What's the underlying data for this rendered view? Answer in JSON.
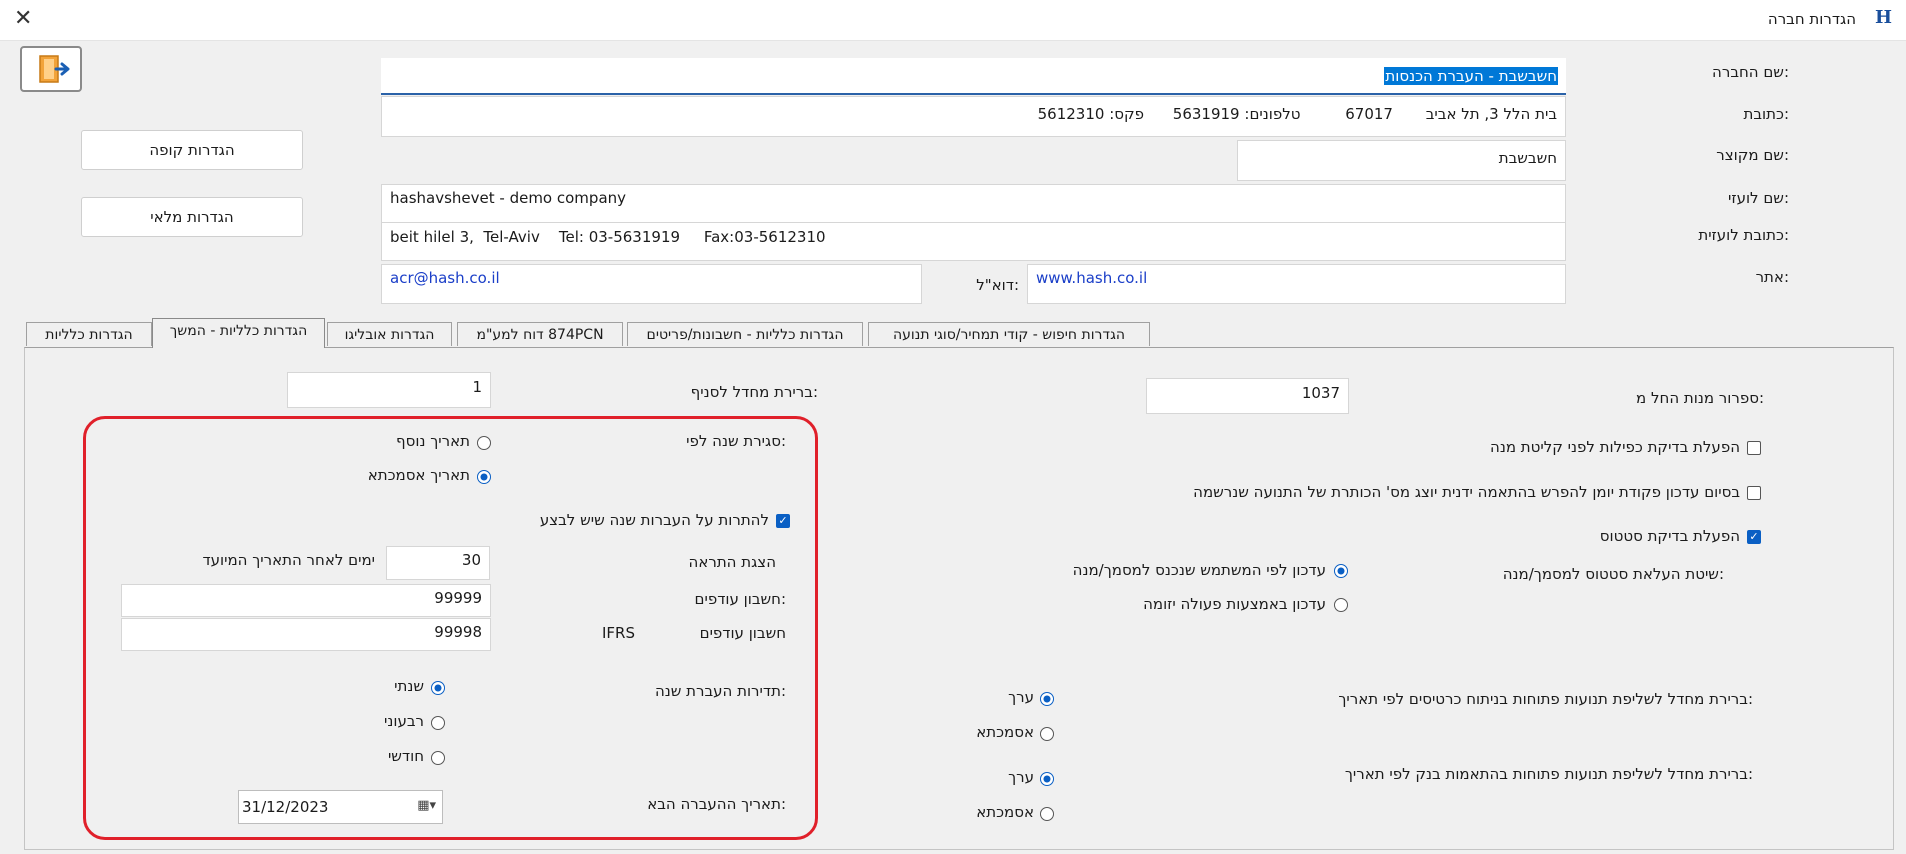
{
  "window": {
    "title": "הגדרות חברה",
    "app_icon": "H"
  },
  "company": {
    "name_label": "שם החברה:",
    "name_value": "חשבשבת - העברת הכנסות",
    "address_label": "כתובת:",
    "address": {
      "street": "בית הלל 3, תל אביב",
      "zip": "67017",
      "phone_label": "טלפונים:",
      "phone": "5631919",
      "fax_label": "פקס:",
      "fax": "5612310"
    },
    "short_name_label": "שם מקוצר:",
    "short_name": "חשבשבת",
    "foreign_name_label": "שם לועזי:",
    "foreign_name": "hashavshevet - demo company",
    "foreign_address_label": "כתובת לועזית:",
    "foreign_address": "beit hilel 3,  Tel-Aviv    Tel: 03-5631919     Fax:03-5612310",
    "site_label": "אתר:",
    "site": "www.hash.co.il",
    "email_label": "דוא\"ל:",
    "email": "acr@hash.co.il"
  },
  "buttons": {
    "cash_settings": "הגדרות קופה",
    "inventory_settings": "הגדרות מלאי"
  },
  "tabs": [
    {
      "label": "הגדרות כלליות",
      "active": false
    },
    {
      "label": "הגדרות כלליות - המשך",
      "active": true
    },
    {
      "label": "הגדרות אובליגו",
      "active": false
    },
    {
      "label": "874PCN  דוח למע\"מ",
      "active": false
    },
    {
      "label": "הגדרות כלליות - חשבונות/פריטים",
      "active": false
    },
    {
      "label": "הגדרות חיפוש - קודי תמחיר/סוגי תנועה",
      "active": false
    }
  ],
  "right_panel": {
    "batch_numbering_label": "ספרור מנות החל מ:",
    "batch_numbering_value": "1037",
    "dup_check_label": "הפעלת בדיקת כפילות לפני קליטת מנה",
    "dup_check": false,
    "journal_update_label": "בסיום עדכון פקודת יומן להפרש בהתאמה ידנית יוצג מס' הכותרת של התנועה שנרשמה",
    "journal_update": false,
    "status_check_label": "הפעלת בדיקת סטטוס",
    "status_check": true,
    "status_method_label": "שיטת העלאת סטטוס למסמך/מנה:",
    "status_method_options": [
      {
        "label": "עדכון לפי המשתמש שנכנס למסמך/מנה",
        "selected": true
      },
      {
        "label": "עדכון באמצעות פעולה יזומה",
        "selected": false
      }
    ],
    "card_analysis_label": "ברירת מחדל לשליפת תנועות פתוחות בניתוח כרטיסים לפי תאריך:",
    "card_analysis_options": [
      {
        "label": "ערך",
        "selected": true
      },
      {
        "label": "אסמכתא",
        "selected": false
      }
    ],
    "bank_match_label": "ברירת מחדל לשליפת תנועות פתוחות בהתאמות בנק לפי תאריך:",
    "bank_match_options": [
      {
        "label": "ערך",
        "selected": true
      },
      {
        "label": "אסמכתא",
        "selected": false
      }
    ]
  },
  "left_panel": {
    "branch_default_label": "ברירת מחדל לסניף:",
    "branch_default_value": "1",
    "year_close_label": "סגירת שנה לפי:",
    "year_close_options": [
      {
        "label": "תאריך נוסף",
        "selected": false
      },
      {
        "label": "תאריך אסמכתא",
        "selected": true
      }
    ],
    "alert_label": "להתרות על העברות שנה שיש לבצע",
    "alert": true,
    "show_alert_label": "הצגת התראה",
    "show_alert_days": "30",
    "show_alert_suffix": "ימים לאחר התאריך המיועד",
    "surplus_label": "חשבון עודפים:",
    "surplus_value": "99999",
    "surplus_ifrs_label": "חשבון עודפים",
    "ifrs_tag": "IFRS",
    "surplus_ifrs_value": "99998",
    "transfer_freq_label": "תדירות העברת שנה:",
    "transfer_freq_options": [
      {
        "label": "שנתי",
        "selected": true
      },
      {
        "label": "רבעוני",
        "selected": false
      },
      {
        "label": "חודשי",
        "selected": false
      }
    ],
    "next_transfer_label": "תאריך ההעברה הבא:",
    "next_transfer_date": "31/12/2023"
  },
  "colors": {
    "accent": "#0a5fc4",
    "highlight_frame": "#e0202a",
    "background": "#f0f0f0"
  }
}
